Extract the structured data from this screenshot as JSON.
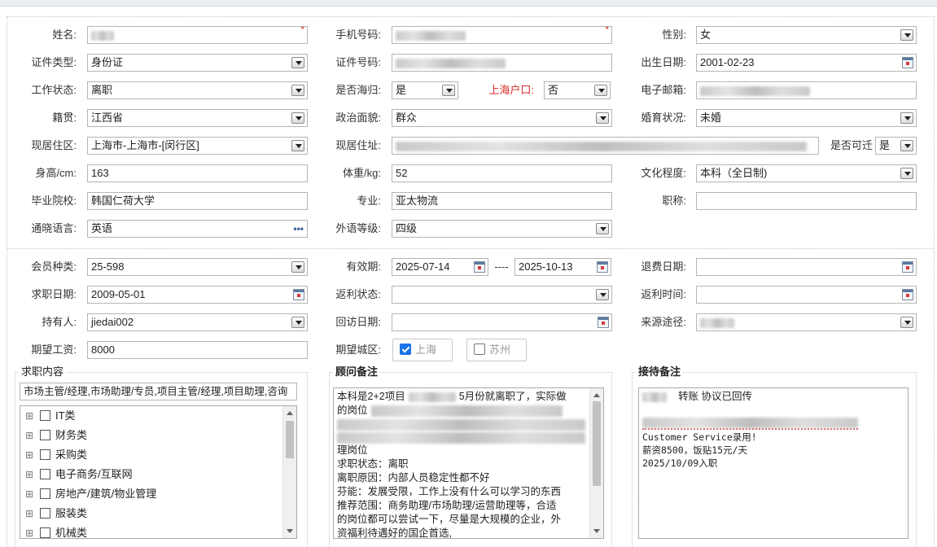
{
  "form": {
    "name_label": "姓名:",
    "phone_label": "手机号码:",
    "gender_label": "性别:",
    "gender_value": "女",
    "id_type_label": "证件类型:",
    "id_type_value": "身份证",
    "id_no_label": "证件号码:",
    "birth_label": "出生日期:",
    "birth_value": "2001-02-23",
    "work_status_label": "工作状态:",
    "work_status_value": "离职",
    "overseas_label": "是否海归:",
    "overseas_value": "是",
    "shanghai_hukou_label": "上海户口:",
    "shanghai_hukou_value": "否",
    "email_label": "电子邮箱:",
    "native_label": "籍贯:",
    "native_value": "江西省",
    "political_label": "政治面貌:",
    "political_value": "群众",
    "marital_label": "婚育状况:",
    "marital_value": "未婚",
    "residence_area_label": "现居住区:",
    "residence_area_value": "上海市-上海市-[闵行区]",
    "address_label": "现居住址:",
    "relocate_label": "是否可迁",
    "relocate_value": "是",
    "height_label": "身高/cm:",
    "height_value": "163",
    "weight_label": "体重/kg:",
    "weight_value": "52",
    "education_label": "文化程度:",
    "education_value": "本科（全日制)",
    "school_label": "毕业院校:",
    "school_value": "韩国仁荷大学",
    "major_label": "专业:",
    "major_value": "亚太物流",
    "title_label": "职称:",
    "title_value": "",
    "language_label": "通晓语言:",
    "language_value": "英语",
    "lang_level_label": "外语等级:",
    "lang_level_value": "四级",
    "member_type_label": "会员种类:",
    "member_type_value": "25-598",
    "validity_label": "有效期:",
    "validity_start": "2025-07-14",
    "validity_sep": "----",
    "validity_end": "2025-10-13",
    "refund_date_label": "退费日期:",
    "refund_date_value": "",
    "job_date_label": "求职日期:",
    "job_date_value": "2009-05-01",
    "rebate_status_label": "返利状态:",
    "rebate_status_value": "",
    "rebate_time_label": "返利时间:",
    "rebate_time_value": "",
    "holder_label": "持有人:",
    "holder_value": "jiedai002",
    "visit_date_label": "回访日期:",
    "visit_date_value": "",
    "source_label": "来源途径:",
    "salary_label": "期望工资:",
    "salary_value": "8000",
    "city_label": "期望城区:",
    "city_shanghai": "上海",
    "city_suzhou": "苏州"
  },
  "job_content": {
    "title": "求职内容",
    "summary": "市场主管/经理,市场助理/专员,项目主管/经理,项目助理,咨询",
    "tree": [
      "IT类",
      "财务类",
      "采购类",
      "电子商务/互联网",
      "房地产/建筑/物业管理",
      "服装类",
      "机械类"
    ]
  },
  "advisor_notes": {
    "title": "顾问备注",
    "lines": [
      "本科是2+2项目",
      "5月份就离职了，实际做",
      "的岗位",
      "理岗位",
      "求职状态：离职",
      "离职原因：内部人员稳定性都不好",
      "芬能：发展受限，工作上没有什么可以学习的东西",
      "推荐范围：商务助理/市场助理/运营助理等，合适",
      "的岗位都可以尝试一下，尽量是大规模的企业，外",
      "资福利待遇好的国企首选,"
    ]
  },
  "reception_notes": {
    "title": "接待备注",
    "line1": "转账    协议已回传",
    "line2": "Customer Service录用!",
    "line3": "薪资8500，饭贴15元/天",
    "line4": "2025/10/09入职"
  }
}
